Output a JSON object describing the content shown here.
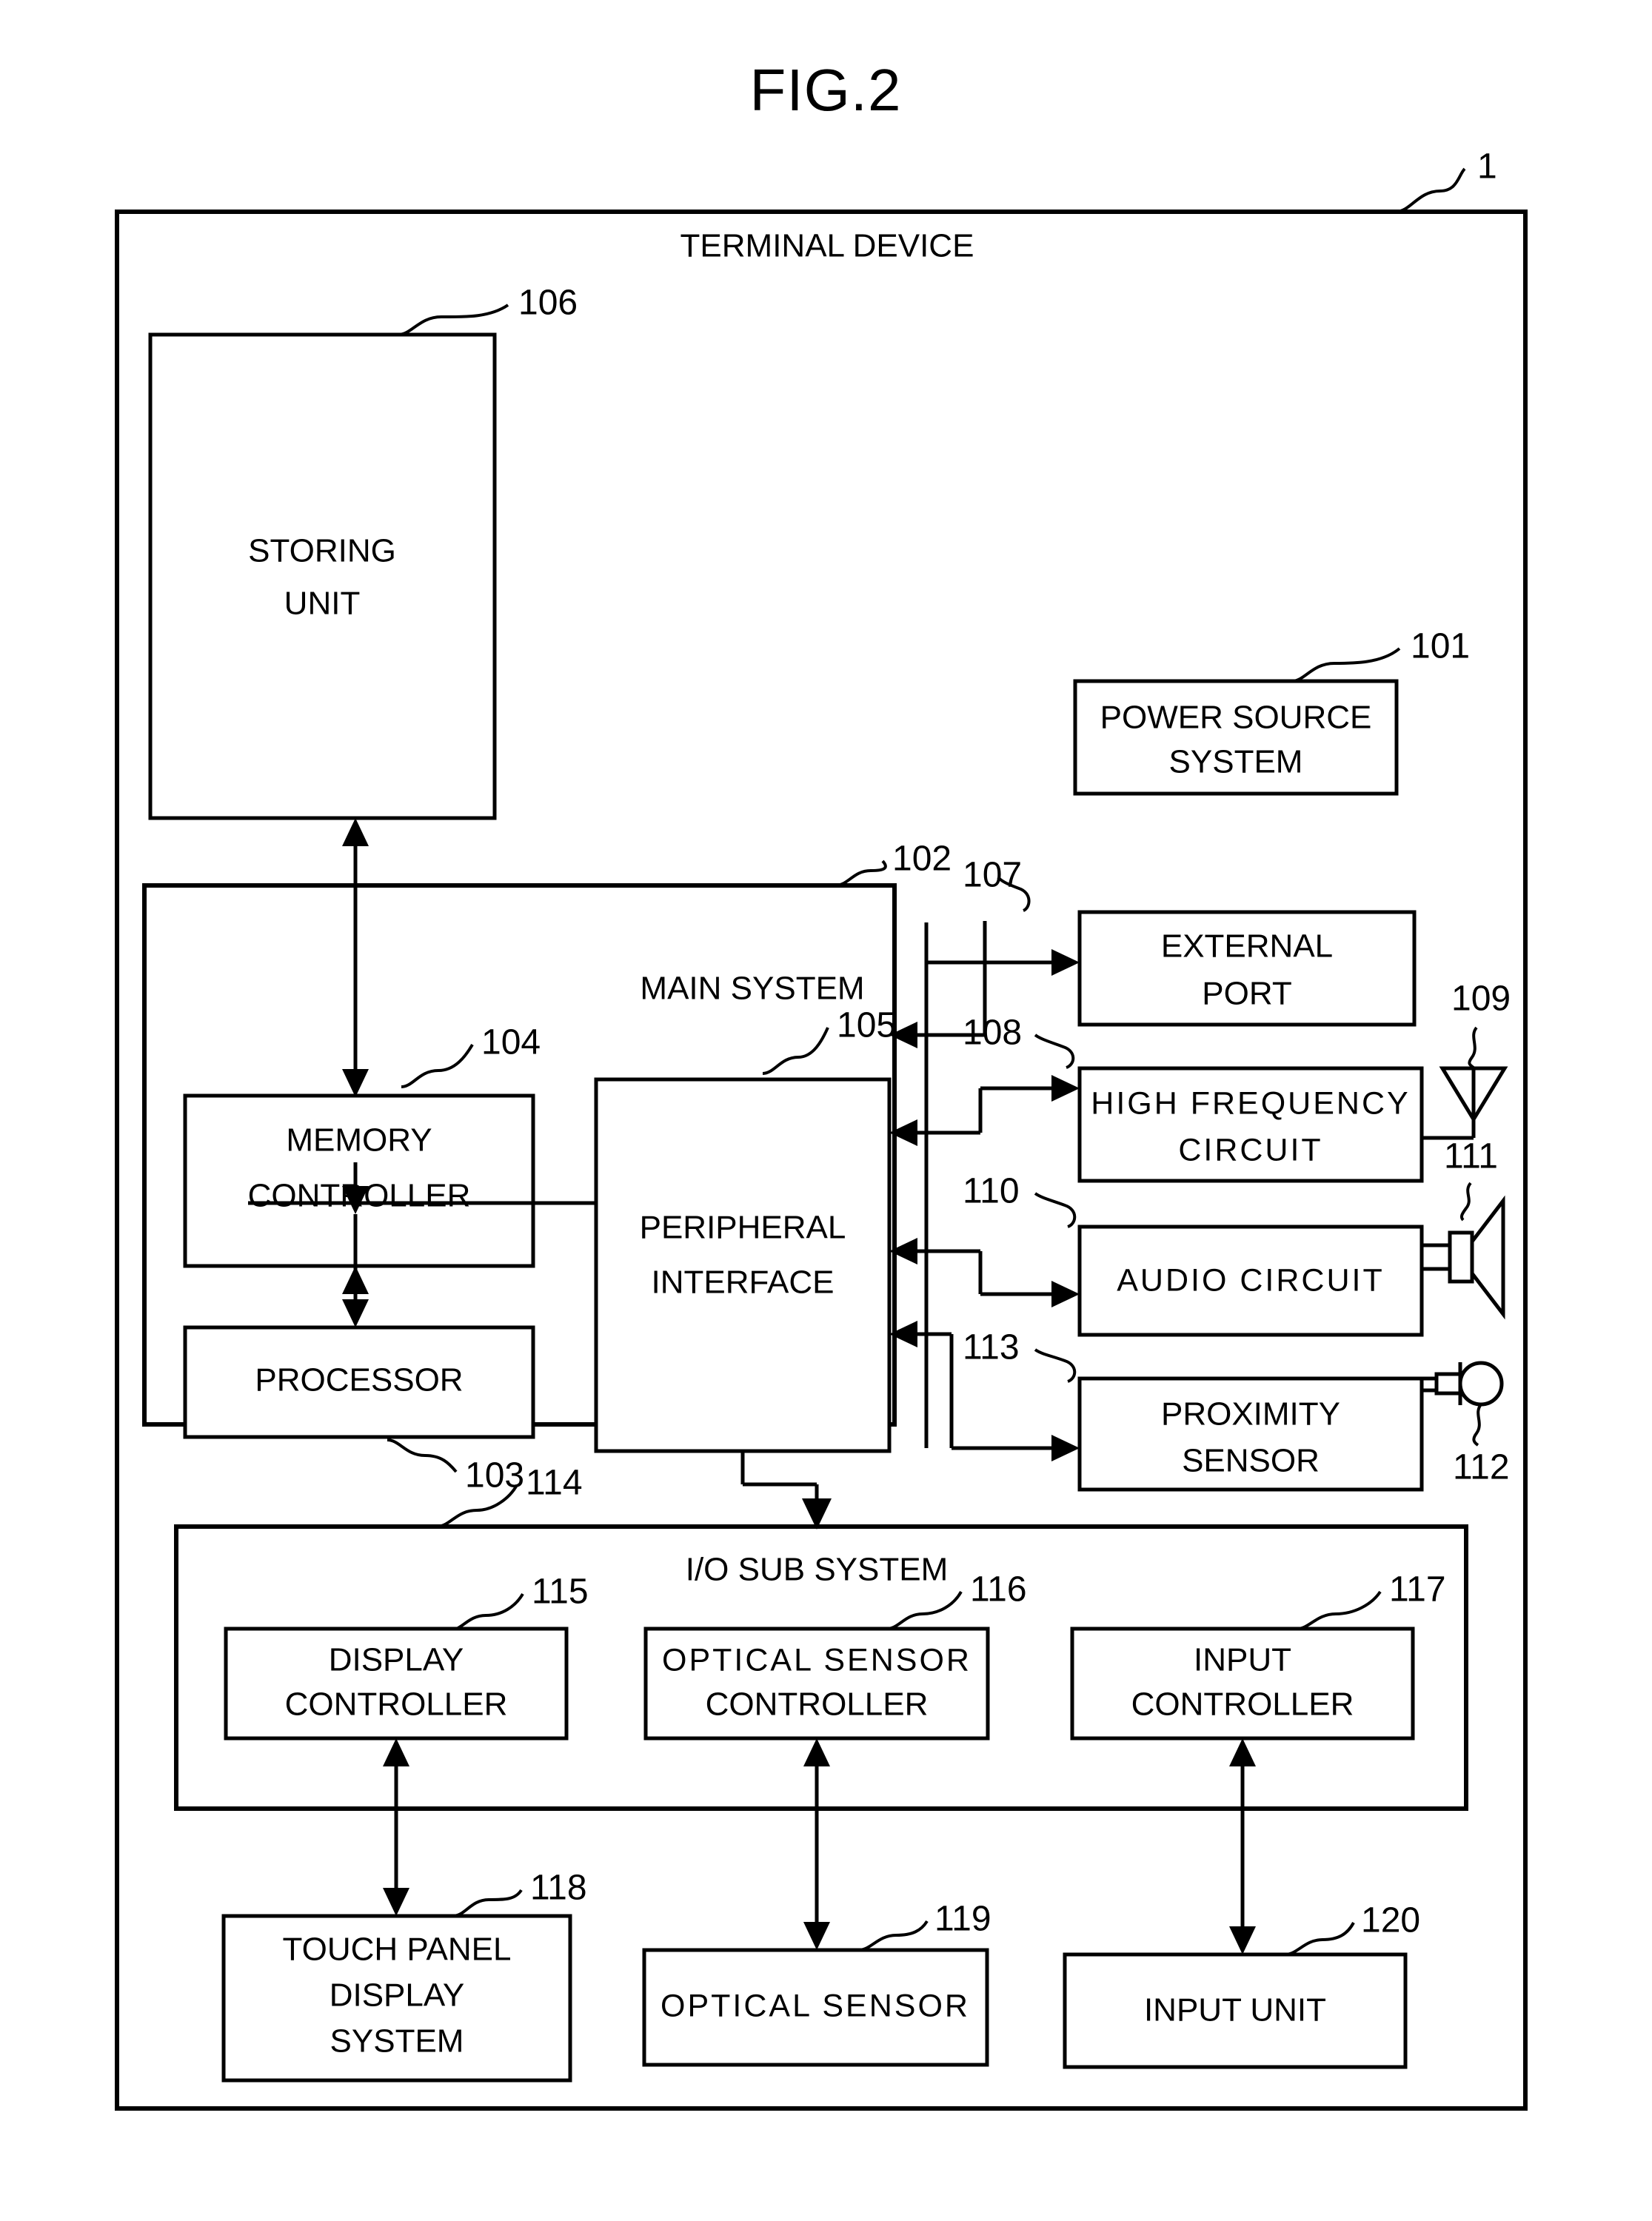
{
  "figure": {
    "title": "FIG.2",
    "root_ref": "1",
    "root_label": "TERMINAL DEVICE"
  },
  "sections": {
    "main_system": {
      "label": "MAIN SYSTEM",
      "ref": "102"
    },
    "io_sub_system": {
      "label": "I/O SUB SYSTEM",
      "ref": "114"
    }
  },
  "blocks": {
    "storing_unit": {
      "ref": "106",
      "line1": "STORING",
      "line2": "UNIT"
    },
    "power_source_system": {
      "ref": "101",
      "line1": "POWER SOURCE",
      "line2": "SYSTEM"
    },
    "memory_controller": {
      "ref": "104",
      "line1": "MEMORY",
      "line2": "CONTROLLER"
    },
    "processor": {
      "ref": "103",
      "line1": "PROCESSOR"
    },
    "peripheral_interface": {
      "ref": "105",
      "line1": "PERIPHERAL",
      "line2": "INTERFACE"
    },
    "external_port": {
      "ref": "107",
      "line1": "EXTERNAL",
      "line2": "PORT"
    },
    "high_frequency_circuit": {
      "ref": "108",
      "line1": "HIGH FREQUENCY",
      "line2": "CIRCUIT"
    },
    "audio_circuit": {
      "ref": "110",
      "line1": "AUDIO CIRCUIT"
    },
    "proximity_sensor": {
      "ref": "113",
      "line1": "PROXIMITY",
      "line2": "SENSOR"
    },
    "display_controller": {
      "ref": "115",
      "line1": "DISPLAY",
      "line2": "CONTROLLER"
    },
    "optical_sensor_controller": {
      "ref": "116",
      "line1": "OPTICAL SENSOR",
      "line2": "CONTROLLER"
    },
    "input_controller": {
      "ref": "117",
      "line1": "INPUT",
      "line2": "CONTROLLER"
    },
    "touch_panel_display_system": {
      "ref": "118",
      "line1": "TOUCH PANEL",
      "line2": "DISPLAY",
      "line3": "SYSTEM"
    },
    "optical_sensor": {
      "ref": "119",
      "line1": "OPTICAL SENSOR"
    },
    "input_unit": {
      "ref": "120",
      "line1": "INPUT UNIT"
    }
  },
  "icons": {
    "antenna": {
      "ref": "109",
      "name": "antenna-icon"
    },
    "speaker": {
      "ref": "111",
      "name": "speaker-icon"
    },
    "microphone": {
      "ref": "112",
      "name": "microphone-icon"
    }
  },
  "colors": {
    "stroke": "#000000",
    "fill": "#ffffff"
  }
}
